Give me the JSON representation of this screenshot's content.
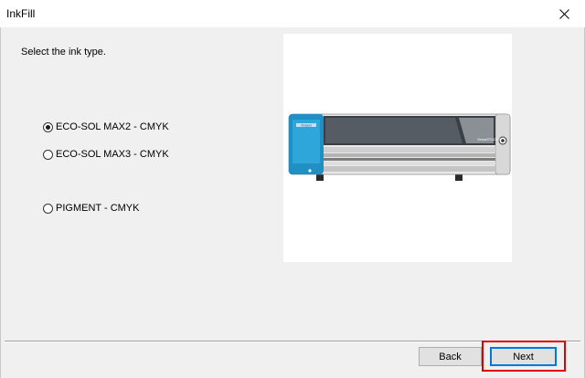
{
  "window": {
    "title": "InkFill",
    "close_icon": "close-icon"
  },
  "prompt": "Select the ink type.",
  "ink_options": [
    {
      "label": "ECO-SOL MAX2 - CMYK",
      "selected": true
    },
    {
      "label": "ECO-SOL MAX3 - CMYK",
      "selected": false
    },
    {
      "label": "PIGMENT - CMYK",
      "selected": false
    }
  ],
  "illustration": {
    "printer_brand": "Roland",
    "printer_model_label": "VersaSTUDIO"
  },
  "footer": {
    "back_label": "Back",
    "next_label": "Next"
  },
  "colors": {
    "accent": "#0078d7",
    "highlight": "#e00000",
    "printer_blue": "#1f8fc4"
  }
}
